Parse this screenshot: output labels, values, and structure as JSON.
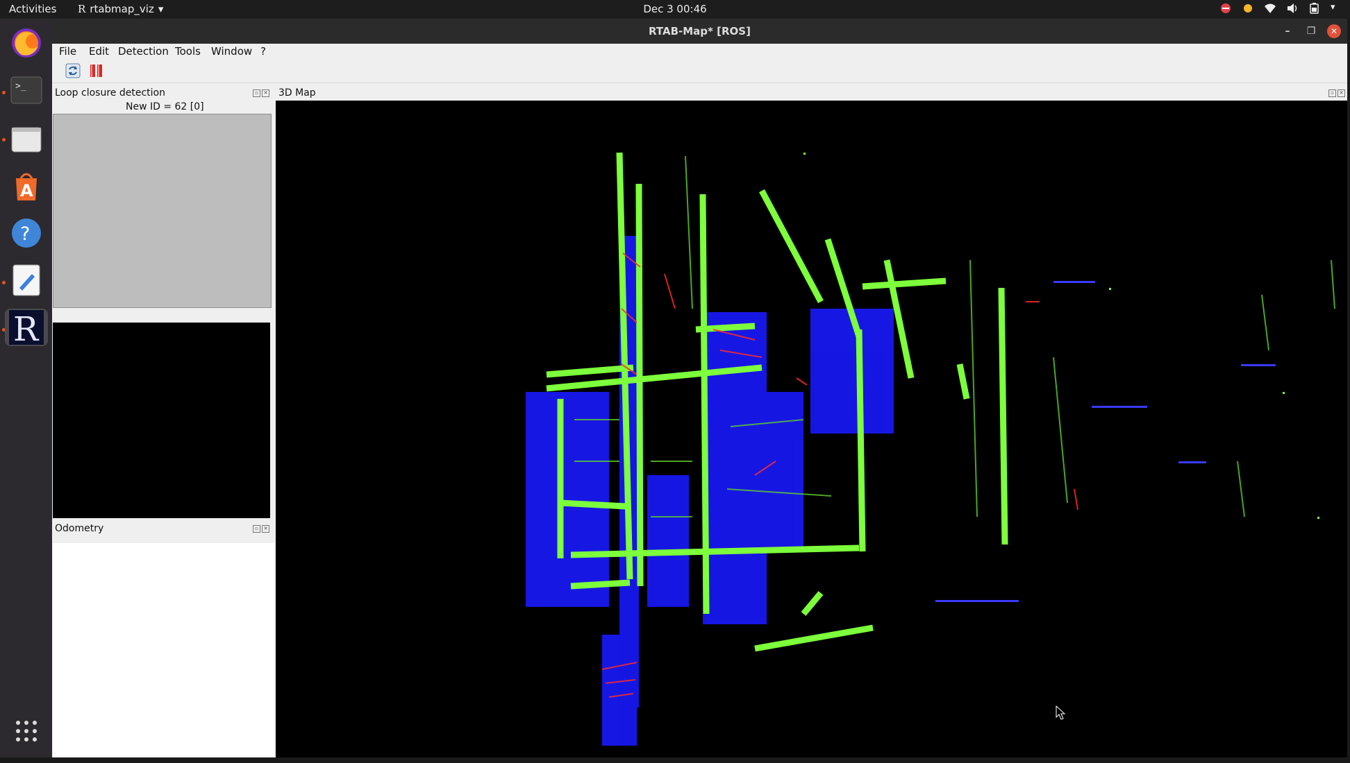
{
  "topbar": {
    "activities": "Activities",
    "app_name": "rtabmap_viz",
    "clock": "Dec 3  00:46"
  },
  "window": {
    "title": "RTAB-Map* [ROS]"
  },
  "menu": {
    "file": "File",
    "edit": "Edit",
    "detection": "Detection",
    "tools": "Tools",
    "window": "Window",
    "help": "?"
  },
  "panels": {
    "loop_closure_title": "Loop closure detection",
    "loop_closure_status": "New ID = 62 [0]",
    "odometry_title": "Odometry",
    "map3d_title": "3D Map"
  },
  "icons": {
    "dock": [
      "firefox-icon",
      "terminal-icon",
      "files-icon",
      "app-store-icon",
      "help-icon",
      "text-editor-icon",
      "rtabmap-icon",
      "app-grid-icon"
    ],
    "toolbar": [
      "refresh-icon",
      "pause-icon"
    ]
  },
  "colors": {
    "point_green": "#7dff3c",
    "point_blue": "#1a1aff",
    "point_red": "#ff2a2a",
    "ubuntu_orange": "#e95420"
  }
}
